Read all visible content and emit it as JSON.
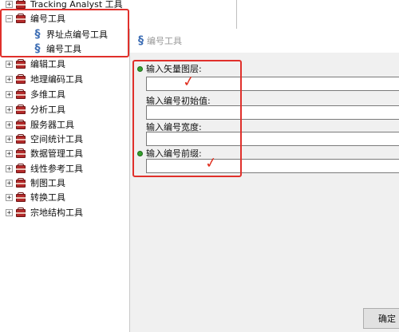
{
  "tree": {
    "items": [
      {
        "label": "Tracking Analyst 工具",
        "expander": "+",
        "icon": "toolbox-icon"
      },
      {
        "label": "编号工具",
        "expander": "−",
        "icon": "toolbox-icon"
      },
      {
        "label": "界址点编号工具",
        "icon": "script-tool-icon"
      },
      {
        "label": "编号工具",
        "icon": "script-tool-icon"
      },
      {
        "label": "编辑工具",
        "expander": "+",
        "icon": "toolbox-icon"
      },
      {
        "label": "地理编码工具",
        "expander": "+",
        "icon": "toolbox-icon"
      },
      {
        "label": "多维工具",
        "expander": "+",
        "icon": "toolbox-icon"
      },
      {
        "label": "分析工具",
        "expander": "+",
        "icon": "toolbox-icon"
      },
      {
        "label": "服务器工具",
        "expander": "+",
        "icon": "toolbox-icon"
      },
      {
        "label": "空间统计工具",
        "expander": "+",
        "icon": "toolbox-icon"
      },
      {
        "label": "数据管理工具",
        "expander": "+",
        "icon": "toolbox-icon"
      },
      {
        "label": "线性参考工具",
        "expander": "+",
        "icon": "toolbox-icon"
      },
      {
        "label": "制图工具",
        "expander": "+",
        "icon": "toolbox-icon"
      },
      {
        "label": "转换工具",
        "expander": "+",
        "icon": "toolbox-icon"
      },
      {
        "label": "宗地结构工具",
        "expander": "+",
        "icon": "toolbox-icon"
      }
    ]
  },
  "dialog": {
    "title": "编号工具",
    "title_icon": "script-tool-icon",
    "fields": [
      {
        "label": "输入矢量图层:",
        "required": true,
        "value": ""
      },
      {
        "label": "输入编号初始值:",
        "required": false,
        "value": ""
      },
      {
        "label": "输入编号宽度:",
        "required": false,
        "value": ""
      },
      {
        "label": "输入编号前缀:",
        "required": true,
        "value": ""
      }
    ],
    "ok_label": "确定"
  },
  "colors": {
    "annotation_red": "#e0302b",
    "required_dot": "#34a02c",
    "dialog_bg": "#f0f0f0"
  }
}
